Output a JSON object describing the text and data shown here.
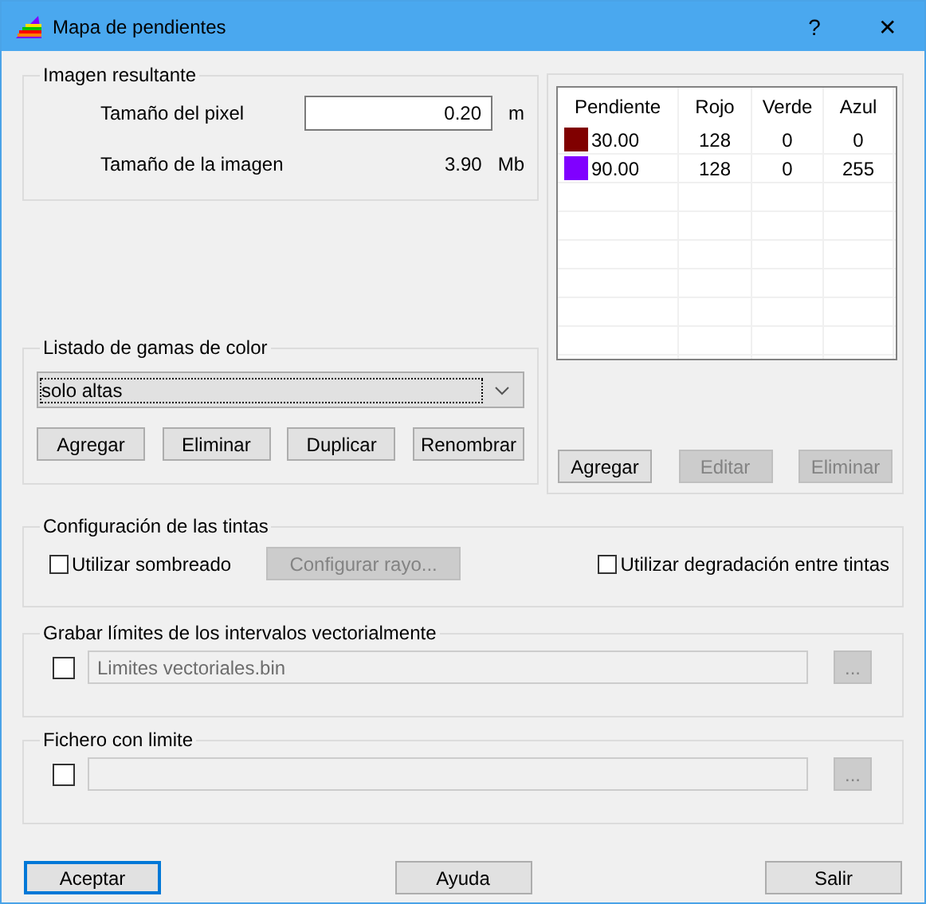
{
  "window": {
    "title": "Mapa de pendientes",
    "help": "?",
    "close": "✕"
  },
  "imagen": {
    "legend": "Imagen resultante",
    "pixel_label": "Tamaño del pixel",
    "pixel_value": "0.20",
    "pixel_unit": "m",
    "size_label": "Tamaño de la imagen",
    "size_value": "3.90",
    "size_unit": "Mb"
  },
  "gamas": {
    "legend": "Listado de gamas de color",
    "selected": "solo altas",
    "buttons": [
      {
        "label": "Agregar",
        "disabled": false
      },
      {
        "label": "Eliminar",
        "disabled": false
      },
      {
        "label": "Duplicar",
        "disabled": false
      },
      {
        "label": "Renombrar",
        "disabled": false
      }
    ]
  },
  "table": {
    "columns": [
      "Pendiente",
      "Rojo",
      "Verde",
      "Azul"
    ],
    "rows": [
      {
        "color": "#800000",
        "cells": [
          "30.00",
          "128",
          "0",
          "0"
        ]
      },
      {
        "color": "#8000ff",
        "cells": [
          "90.00",
          "128",
          "0",
          "255"
        ]
      }
    ],
    "buttons": [
      {
        "label": "Agregar",
        "disabled": false
      },
      {
        "label": "Editar",
        "disabled": true
      },
      {
        "label": "Eliminar",
        "disabled": true
      }
    ]
  },
  "tintas": {
    "legend": "Configuración de las tintas",
    "shade": {
      "label": "Utilizar sombreado",
      "checked": false
    },
    "ray_button": {
      "label": "Configurar rayo...",
      "disabled": true
    },
    "gradient": {
      "label": "Utilizar degradación entre tintas",
      "checked": false
    }
  },
  "grabar": {
    "legend": "Grabar límites de los intervalos vectorialmente",
    "checked": false,
    "value": "Limites vectoriales.bin",
    "browse": "..."
  },
  "fichero": {
    "legend": "Fichero con limite",
    "checked": false,
    "browse": "..."
  },
  "footer": [
    {
      "label": "Aceptar",
      "default": true
    },
    {
      "label": "Ayuda",
      "default": false
    },
    {
      "label": "Salir",
      "default": false
    }
  ]
}
